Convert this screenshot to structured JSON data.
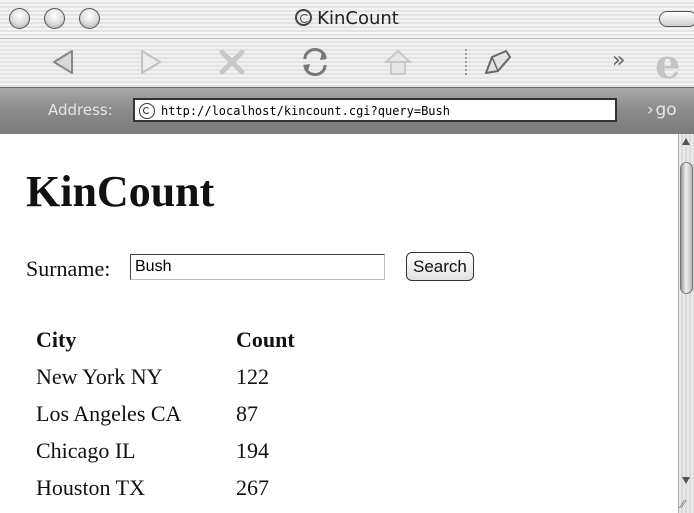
{
  "window": {
    "title": "KinCount"
  },
  "address_bar": {
    "label": "Address:",
    "url": "http://localhost/kincount.cgi?query=Bush",
    "go_label": "go"
  },
  "toolbar": {
    "more_label": "»"
  },
  "page": {
    "title": "KinCount",
    "search_label": "Surname:",
    "search_value": "Bush",
    "search_button": "Search"
  },
  "table": {
    "headers": [
      "City",
      "Count"
    ],
    "rows": [
      [
        "New York NY",
        "122"
      ],
      [
        "Los Angeles CA",
        "87"
      ],
      [
        "Chicago IL",
        "194"
      ],
      [
        "Houston TX",
        "267"
      ]
    ]
  }
}
